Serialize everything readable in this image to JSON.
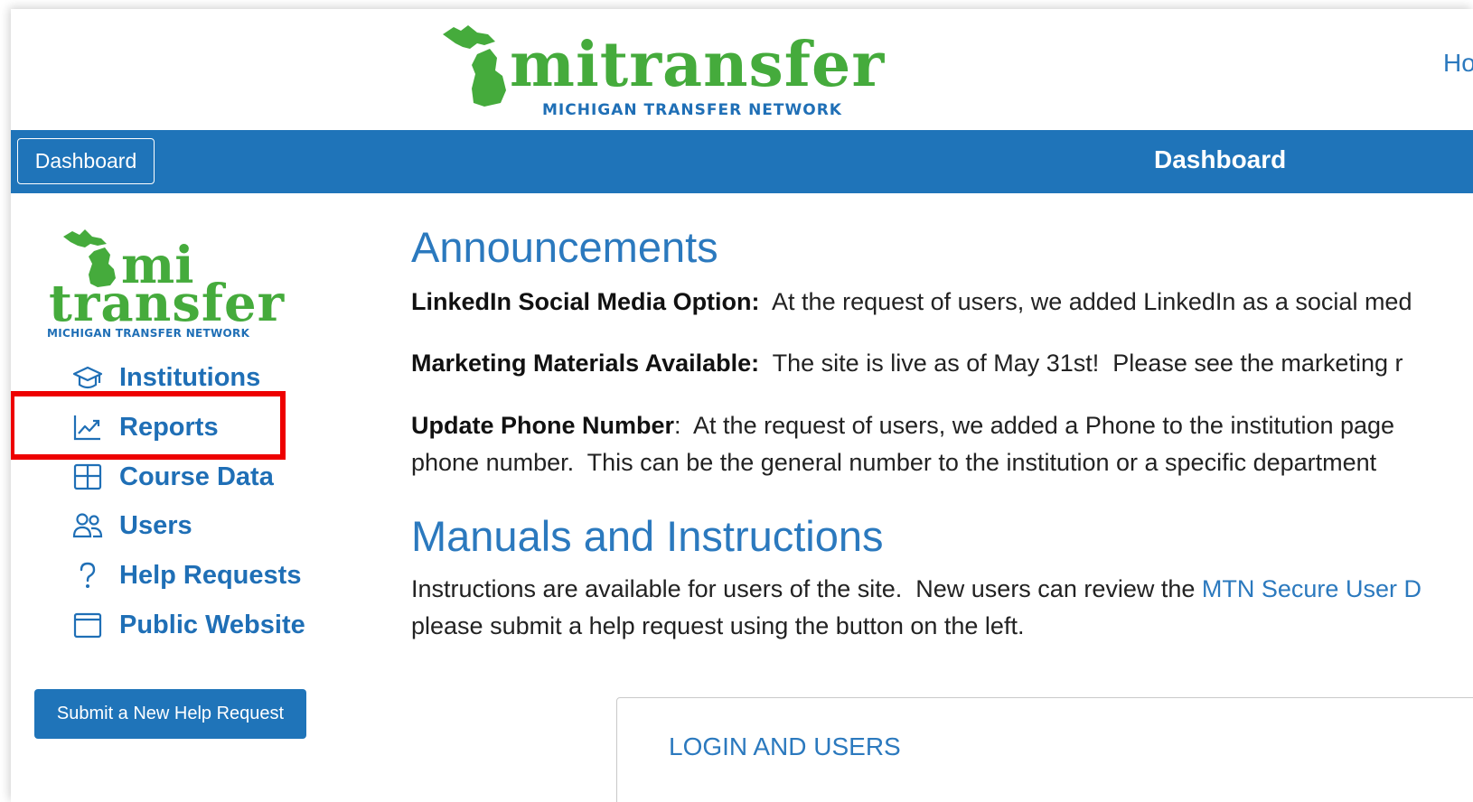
{
  "header": {
    "logo_word": "mitransfer",
    "logo_tagline": "MICHIGAN TRANSFER NETWORK",
    "right_link": "Ho"
  },
  "navbar": {
    "button_label": "Dashboard",
    "title": "Dashboard",
    "color": "#1f74b9"
  },
  "sidebar": {
    "logo_line1": "mi",
    "logo_line2": "transfer",
    "logo_tagline": "MICHIGAN TRANSFER NETWORK",
    "items": [
      {
        "label": "Institutions",
        "icon": "graduation-cap-icon"
      },
      {
        "label": "Reports",
        "icon": "line-chart-icon"
      },
      {
        "label": "Course Data",
        "icon": "table-icon"
      },
      {
        "label": "Users",
        "icon": "users-icon"
      },
      {
        "label": "Help Requests",
        "icon": "question-icon"
      },
      {
        "label": "Public Website",
        "icon": "window-icon"
      }
    ],
    "help_button": "Submit a New Help Request",
    "highlighted_item": "Reports"
  },
  "main": {
    "announcements_title": "Announcements",
    "announcements": [
      {
        "bold": "LinkedIn Social Media Option:",
        "text": "  At the request of users, we added LinkedIn as a social med"
      },
      {
        "bold": "Marketing Materials Available:",
        "text": "  The site is live as of May 31st!  Please see the marketing r"
      },
      {
        "bold": "Update Phone Number",
        "text": ":  At the request of users, we added a Phone to the institution page",
        "line2": "phone number.  This can be the general number to the institution or a specific department"
      }
    ],
    "manuals_title": "Manuals and Instructions",
    "manuals_text1": "Instructions are available for users of the site.  New users can review the ",
    "manuals_link": "MTN Secure User D",
    "manuals_text2": "please submit a help request using the button on the left.",
    "panel_title": "LOGIN AND USERS"
  },
  "colors": {
    "brand_green": "#45ab3c",
    "brand_blue": "#1f74b9",
    "link_blue": "#2b79be",
    "highlight_red": "#ee0000"
  }
}
